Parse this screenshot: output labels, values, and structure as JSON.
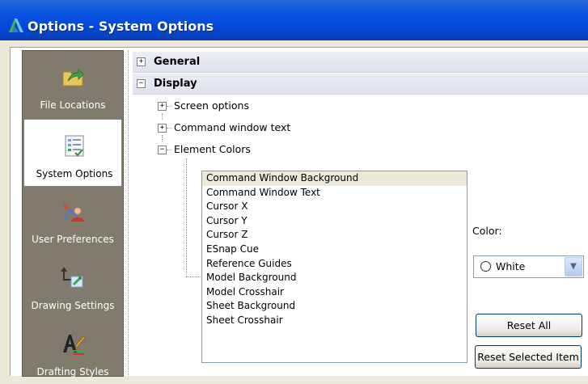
{
  "window": {
    "title": "Options - System Options"
  },
  "nav": {
    "items": [
      {
        "label": "File Locations",
        "icon": "folder-arrow-icon",
        "selected": false
      },
      {
        "label": "System Options",
        "icon": "checklist-icon",
        "selected": true
      },
      {
        "label": "User Preferences",
        "icon": "user-preferences-icon",
        "selected": false
      },
      {
        "label": "Drawing Settings",
        "icon": "drawing-settings-icon",
        "selected": false
      },
      {
        "label": "Drafting Styles",
        "icon": "drafting-styles-icon",
        "selected": false
      }
    ]
  },
  "tree": {
    "general": {
      "label": "General",
      "expanded": false
    },
    "display": {
      "label": "Display",
      "expanded": true,
      "children": [
        {
          "label": "Screen options",
          "expanded": false
        },
        {
          "label": "Command window text",
          "expanded": false
        },
        {
          "label": "Element Colors",
          "expanded": true
        }
      ]
    }
  },
  "element_colors": {
    "items": [
      "Command Window Background",
      "Command Window Text",
      "Cursor X",
      "Cursor Y",
      "Cursor Z",
      "ESnap Cue",
      "Reference Guides",
      "Model Background",
      "Model Crosshair",
      "Sheet Background",
      "Sheet Crosshair"
    ],
    "selected_index": 0,
    "color_label": "Color:",
    "color_value": "White",
    "reset_all_label": "Reset All",
    "reset_selected_label": "Reset Selected Item"
  },
  "colors": {
    "titlebar": "#0a55e0",
    "nav_bg": "#817b6e",
    "group_bg": "#dfe1f0",
    "selected_item_bg": "#ece9d8"
  }
}
